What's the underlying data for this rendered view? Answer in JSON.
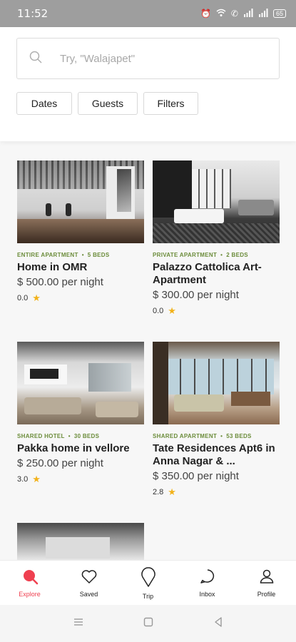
{
  "status": {
    "time": "11:52",
    "battery": "65"
  },
  "search": {
    "placeholder": "Try, \"Walajapet\""
  },
  "filters": [
    "Dates",
    "Guests",
    "Filters"
  ],
  "listings": [
    {
      "type": "ENTIRE APARTMENT",
      "beds": "5 BEDS",
      "title": "Home in OMR",
      "price": "$ 500.00 per night",
      "rating": "0.0"
    },
    {
      "type": "PRIVATE APARTMENT",
      "beds": "2 BEDS",
      "title": "Palazzo Cattolica Art-Apartment",
      "price": "$ 300.00 per night",
      "rating": "0.0"
    },
    {
      "type": "SHARED HOTEL",
      "beds": "30 BEDS",
      "title": "Pakka home in vellore",
      "price": "$ 250.00 per night",
      "rating": "3.0"
    },
    {
      "type": "SHARED APARTMENT",
      "beds": "53 BEDS",
      "title": "Tate Residences Apt6 in Anna Nagar & ...",
      "price": "$ 350.00 per night",
      "rating": "2.8"
    }
  ],
  "nav": [
    {
      "label": "Explore",
      "icon": "search-icon",
      "active": true
    },
    {
      "label": "Saved",
      "icon": "heart-icon",
      "active": false
    },
    {
      "label": "Trip",
      "icon": "map-pin-icon",
      "active": false
    },
    {
      "label": "Inbox",
      "icon": "chat-icon",
      "active": false
    },
    {
      "label": "Profile",
      "icon": "user-icon",
      "active": false
    }
  ],
  "colors": {
    "accent": "#ef4050",
    "meta_green": "#6b8c3a",
    "star": "#f2b21b"
  }
}
